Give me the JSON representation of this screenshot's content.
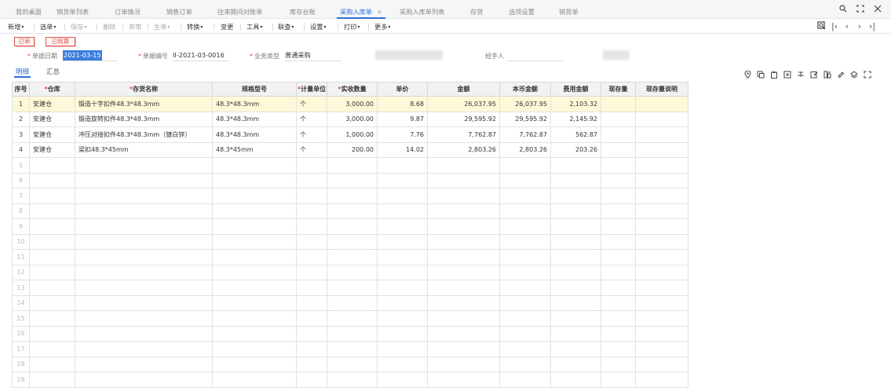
{
  "tabs": [
    {
      "label": "我的桌面"
    },
    {
      "label": "销货单列表"
    },
    {
      "label": "订单情况"
    },
    {
      "label": "销售订单"
    },
    {
      "label": "往来期间对账单"
    },
    {
      "label": "库存台账"
    },
    {
      "label": "采购入库单",
      "active": true,
      "close": "×"
    },
    {
      "label": "采购入库单列表"
    },
    {
      "label": "存货"
    },
    {
      "label": "选项设置"
    },
    {
      "label": "销货单"
    }
  ],
  "window_icons": [
    "search-icon",
    "maximize-icon",
    "close-icon"
  ],
  "toolbar": {
    "new": "新增",
    "pick": "选单",
    "save": "保存",
    "delete": "删除",
    "unaudit": "弃审",
    "generate": "生单",
    "convert": "转换",
    "change": "变更",
    "tools": "工具",
    "lookup": "联查",
    "settings": "设置",
    "print": "打印",
    "more": "更多"
  },
  "nav_icons": [
    "locate-icon",
    "first-icon",
    "prev-icon",
    "next-icon",
    "last-icon"
  ],
  "status": {
    "audited": "已审",
    "costed": "已核算"
  },
  "header": {
    "date_label": "单据日期",
    "date_value": "2021-03-15",
    "code_label": "单据编号",
    "code_value": "II-2021-03-0016",
    "biz_label": "业务类型",
    "biz_value": "普通采购",
    "handler_label": "经手人",
    "handler_value": ""
  },
  "subtabs": {
    "detail": "明细",
    "summary": "汇总"
  },
  "row_tool_icons": [
    "location-icon",
    "copy-row-icon",
    "paste-row-icon",
    "insert-row-icon",
    "strikethrough-icon",
    "edit-icon",
    "split-icon",
    "tag-icon",
    "stack-icon",
    "expand-icon"
  ],
  "table": {
    "columns": [
      {
        "label": "序号",
        "required": false
      },
      {
        "label": "仓库",
        "required": true
      },
      {
        "label": "存货名称",
        "required": true
      },
      {
        "label": "规格型号",
        "required": false
      },
      {
        "label": "计量单位",
        "required": true
      },
      {
        "label": "实收数量",
        "required": true
      },
      {
        "label": "单价",
        "required": false
      },
      {
        "label": "金额",
        "required": false
      },
      {
        "label": "本币金额",
        "required": false
      },
      {
        "label": "费用金额",
        "required": false
      },
      {
        "label": "现存量",
        "required": false
      },
      {
        "label": "现存量说明",
        "required": false
      }
    ],
    "rows": [
      {
        "idx": "1",
        "warehouse": "安建仓",
        "name": "锻造十字扣件48.3*48.3mm",
        "spec": "48.3*48.3mm",
        "unit": "个",
        "qty": "3,000.00",
        "price": "8.68",
        "amount": "26,037.95",
        "local_amount": "26,037.95",
        "fee": "2,103.32",
        "stock": "",
        "stock_note": ""
      },
      {
        "idx": "2",
        "warehouse": "安建仓",
        "name": "锻造旋转扣件48.3*48.3mm",
        "spec": "48.3*48.3mm",
        "unit": "个",
        "qty": "3,000.00",
        "price": "9.87",
        "amount": "29,595.92",
        "local_amount": "29,595.92",
        "fee": "2,145.92",
        "stock": "",
        "stock_note": ""
      },
      {
        "idx": "3",
        "warehouse": "安建仓",
        "name": "冲压对接扣件48.3*48.3mm（镀白锌）",
        "spec": "48.3*48.3mm",
        "unit": "个",
        "qty": "1,000.00",
        "price": "7.76",
        "amount": "7,762.87",
        "local_amount": "7,762.87",
        "fee": "562.87",
        "stock": "",
        "stock_note": ""
      },
      {
        "idx": "4",
        "warehouse": "安建仓",
        "name": "梁扣48.3*45mm",
        "spec": "48.3*45mm",
        "unit": "个",
        "qty": "200.00",
        "price": "14.02",
        "amount": "2,803.26",
        "local_amount": "2,803.26",
        "fee": "203.26",
        "stock": "",
        "stock_note": ""
      }
    ],
    "empty_rows": [
      "5",
      "6",
      "7",
      "8",
      "9",
      "10",
      "11",
      "12",
      "13",
      "14",
      "15",
      "16",
      "17",
      "18",
      "19"
    ]
  }
}
